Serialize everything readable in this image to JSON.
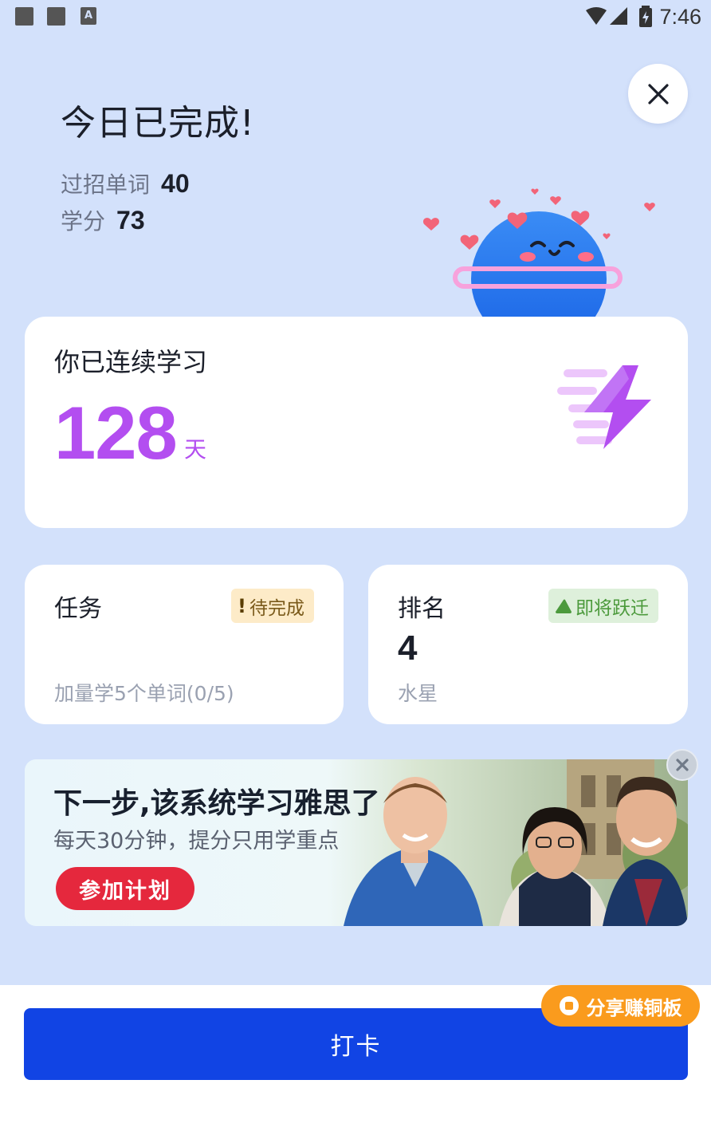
{
  "status_bar": {
    "time": "7:46"
  },
  "header": {
    "title": "今日已完成!",
    "words_label": "过招单词",
    "words_value": "40",
    "credits_label": "学分",
    "credits_value": "73"
  },
  "streak": {
    "label": "你已连续学习",
    "days": "128",
    "unit": "天"
  },
  "task": {
    "title": "任务",
    "badge_icon": "!",
    "badge": "待完成",
    "detail": "加量学5个单词(0/5)"
  },
  "rank": {
    "title": "排名",
    "badge": "即将跃迁",
    "value": "4",
    "planet": "水星"
  },
  "banner": {
    "title": "下一步,该系统学习雅思了",
    "subtitle": "每天30分钟，提分只用学重点",
    "button": "参加计划"
  },
  "footer": {
    "share": "分享赚铜板",
    "checkin": "打卡"
  },
  "colors": {
    "accent": "#1144e4",
    "streak": "#b34ef0",
    "share": "#fa9b1d",
    "banner_button": "#e5283d"
  }
}
